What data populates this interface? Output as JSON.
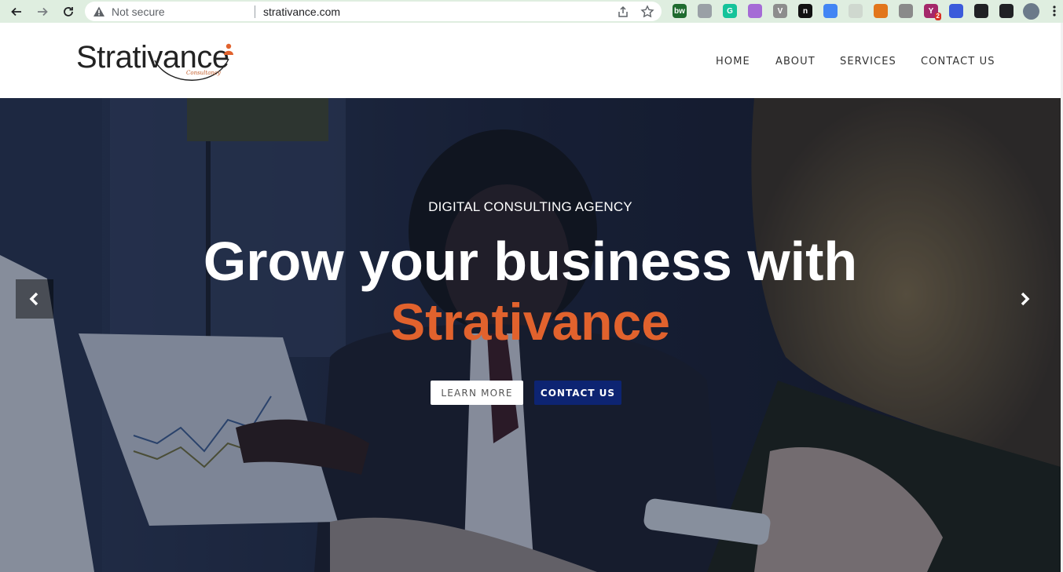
{
  "browser": {
    "security_label": "Not secure",
    "url": "strativance.com",
    "extensions": [
      {
        "name": "bw",
        "text": "bw",
        "color": "#1f6b2f"
      },
      {
        "name": "qr",
        "text": "",
        "color": "#9aa0a6"
      },
      {
        "name": "grammarly",
        "text": "G",
        "color": "#15c39a"
      },
      {
        "name": "drop",
        "text": "",
        "color": "#a56bd6"
      },
      {
        "name": "vivaldi",
        "text": "V",
        "color": "#8d8d8d"
      },
      {
        "name": "notion",
        "text": "n",
        "color": "#111111"
      },
      {
        "name": "color",
        "text": "",
        "color": "#4285f4"
      },
      {
        "name": "phone",
        "text": "",
        "color": "#cfd8cf"
      },
      {
        "name": "metamask",
        "text": "",
        "color": "#e2761b"
      },
      {
        "name": "camera",
        "text": "",
        "color": "#8a8a8a"
      },
      {
        "name": "yoast",
        "text": "Y",
        "color": "#a4286a",
        "badge": "2"
      },
      {
        "name": "screen",
        "text": "",
        "color": "#3b5bdb"
      },
      {
        "name": "puzzle",
        "text": "",
        "color": "#202124"
      },
      {
        "name": "sidepanel",
        "text": "",
        "color": "#202124"
      }
    ]
  },
  "site": {
    "logo_text": "Strativance",
    "logo_subtext": "Consultancy",
    "nav": [
      "HOME",
      "ABOUT",
      "SERVICES",
      "CONTACT US"
    ]
  },
  "hero": {
    "eyebrow": "DIGITAL CONSULTING AGENCY",
    "headline": "Grow your business with",
    "headline_accent": "Strativance",
    "learn_more": "LEARN MORE",
    "contact_us": "CONTACT US"
  },
  "colors": {
    "accent": "#e1622d",
    "primary_button": "#0d2472",
    "chrome_bg": "#dfeee0"
  }
}
